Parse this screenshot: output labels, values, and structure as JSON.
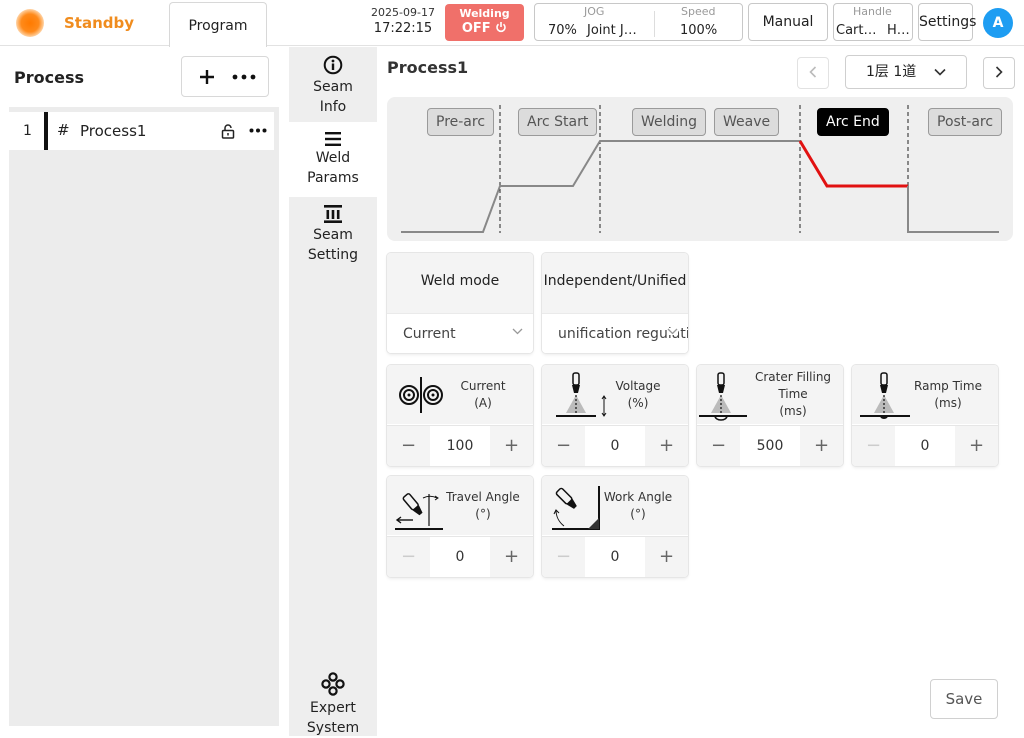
{
  "topbar": {
    "status": "Standby",
    "status_color": "#f08c1e",
    "tab_program": "Program",
    "date": "2025-09-17",
    "time": "17:22:15",
    "welding_label": "Welding",
    "welding_state": "OFF",
    "welding_color": "#f0706a",
    "jog_label": "JOG",
    "jog_value": "70%",
    "jog_mode": "Joint J…",
    "speed_label": "Speed",
    "speed_value": "100%",
    "manual": "Manual",
    "handle_label": "Handle",
    "handle_value1": "Cart…",
    "handle_value2": "H…",
    "settings": "Settings",
    "avatar": "A",
    "avatar_color": "#1e9df2"
  },
  "left": {
    "title": "Process",
    "items": [
      {
        "index": "1",
        "hash": "#",
        "name": "Process1"
      }
    ]
  },
  "vnav": [
    {
      "label1": "Seam",
      "label2": "Info",
      "icon": "info-icon"
    },
    {
      "label1": "Weld",
      "label2": "Params",
      "icon": "list-icon"
    },
    {
      "label1": "Seam",
      "label2": "Setting",
      "icon": "seam-setting-icon"
    },
    {
      "label1": "Expert",
      "label2": "System",
      "icon": "expert-icon"
    }
  ],
  "main": {
    "title": "Process1",
    "layer": "1层  1道",
    "phases": [
      "Pre-arc",
      "Arc Start",
      "Welding",
      "Weave",
      "Arc End",
      "Post-arc"
    ],
    "active_phase": "Arc End",
    "weld_mode_label": "Weld mode",
    "weld_mode_value": "Current",
    "indep_label": "Independent/Unified",
    "indep_value": "unification regulation",
    "params": [
      {
        "label": "Current\n(A)",
        "value": "100",
        "icon": "wire-feed-icon"
      },
      {
        "label": "Voltage\n(%)",
        "value": "0",
        "icon": "torch-voltage-icon"
      },
      {
        "label": "Crater Filling\nTime\n(ms)",
        "value": "500",
        "icon": "torch-crater-icon"
      },
      {
        "label": "Ramp Time\n(ms)",
        "value": "0",
        "icon": "torch-ramp-icon"
      },
      {
        "label": "Travel Angle\n(°)",
        "value": "0",
        "icon": "travel-angle-icon"
      },
      {
        "label": "Work Angle\n(°)",
        "value": "0",
        "icon": "work-angle-icon"
      }
    ],
    "save": "Save",
    "profile_color": "#888888",
    "profile_active_color": "#e11111"
  }
}
